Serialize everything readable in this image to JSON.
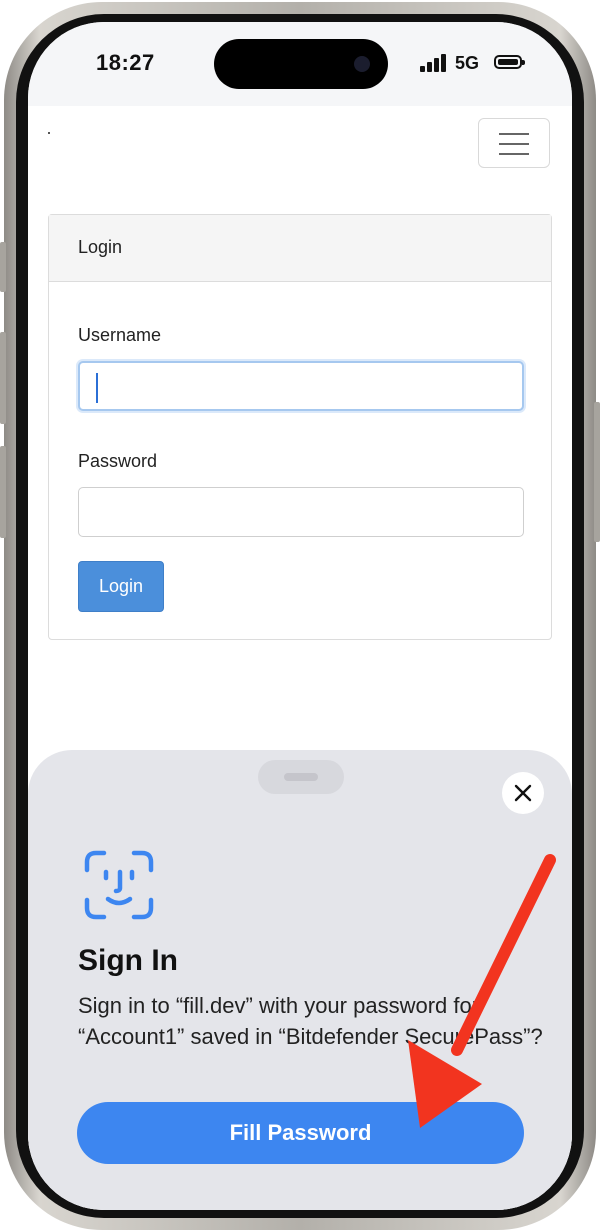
{
  "status_bar": {
    "time": "18:27",
    "network": "5G"
  },
  "navbar": {
    "menu_icon": "hamburger-menu-icon"
  },
  "login_card": {
    "title": "Login",
    "username_label": "Username",
    "username_value": "",
    "password_label": "Password",
    "password_value": "",
    "submit_label": "Login"
  },
  "sign_in_sheet": {
    "icon": "face-id-icon",
    "title": "Sign In",
    "message": "Sign in to “fill.dev” with your password for “Account1” saved in “Bitdefender SecurePass”?",
    "fill_button_label": "Fill Password",
    "close_icon": "close-icon"
  },
  "colors": {
    "accent_blue": "#3d86f0",
    "login_button": "#4b8fdb",
    "annotation_arrow": "#f2341f"
  }
}
